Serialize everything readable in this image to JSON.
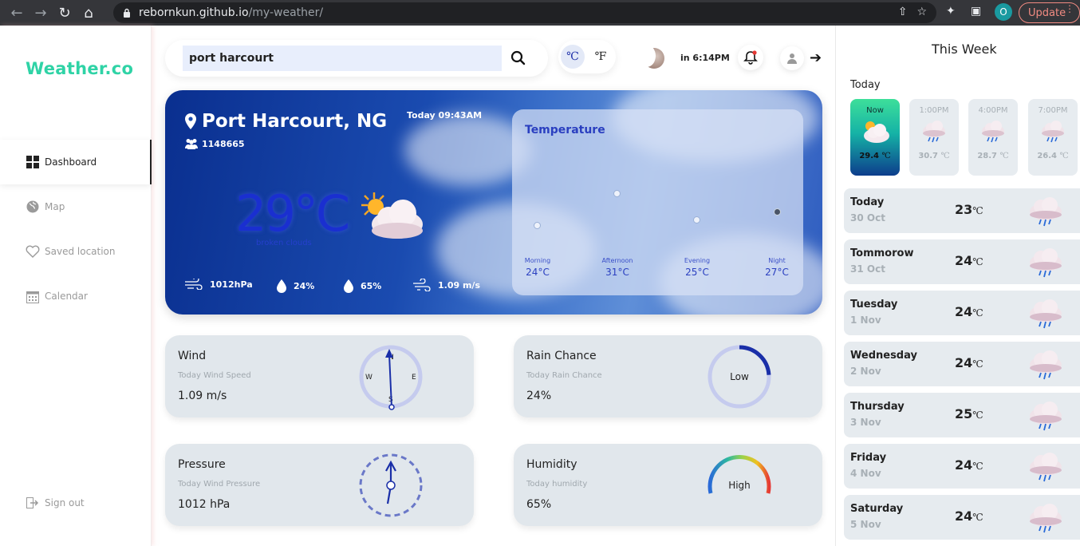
{
  "browser": {
    "url_host": "rebornkun.github.io",
    "url_path": "/my-weather/",
    "profile_initial": "O",
    "update_label": "Update"
  },
  "sidebar": {
    "logo": "Weather.co",
    "items": [
      {
        "label": "Dashboard",
        "icon": "dashboard-icon",
        "active": true
      },
      {
        "label": "Map",
        "icon": "globe-icon"
      },
      {
        "label": "Saved location",
        "icon": "heart-icon"
      },
      {
        "label": "Calendar",
        "icon": "calendar-icon"
      }
    ],
    "signout": "Sign out"
  },
  "topbar": {
    "search_value": "port harcourt",
    "unit_c": "℃",
    "unit_f": "℉",
    "time_text": "in 6:14PM"
  },
  "hero": {
    "city": "Port Harcourt, NG",
    "population": "1148665",
    "today_time": "Today 09:43AM",
    "temp": "29°C",
    "description": "broken clouds",
    "stats": {
      "pressure": "1012hPa",
      "humidity": "24%",
      "rain": "65%",
      "wind": "1.09 m/s"
    },
    "temperature_panel": {
      "title": "Temperature",
      "periods": [
        {
          "label": "Morning",
          "value": "24°C"
        },
        {
          "label": "Afternoon",
          "value": "31°C"
        },
        {
          "label": "Evening",
          "value": "25°C"
        },
        {
          "label": "Night",
          "value": "27°C"
        }
      ]
    }
  },
  "cards": {
    "wind": {
      "title": "Wind",
      "subtitle": "Today Wind Speed",
      "value": "1.09 m/s",
      "n": "N",
      "e": "E",
      "s": "S",
      "w": "W"
    },
    "rain": {
      "title": "Rain Chance",
      "subtitle": "Today Rain Chance",
      "value": "24%",
      "gauge_label": "Low",
      "gauge_fraction": 0.24
    },
    "pressure": {
      "title": "Pressure",
      "subtitle": "Today Wind Pressure",
      "value": "1012 hPa"
    },
    "humidity": {
      "title": "Humidity",
      "subtitle": "Today humidity",
      "value": "65%",
      "gauge_label": "High"
    }
  },
  "week": {
    "title": "This Week",
    "today_label": "Today",
    "hours": [
      {
        "time": "Now",
        "temp": "29.4",
        "unit": "℃",
        "icon": "sun-cloud-icon",
        "now": true
      },
      {
        "time": "1:00PM",
        "temp": "30.7",
        "unit": "℃",
        "icon": "rain-cloud-icon"
      },
      {
        "time": "4:00PM",
        "temp": "28.7",
        "unit": "℃",
        "icon": "rain-cloud-icon"
      },
      {
        "time": "7:00PM",
        "temp": "26.4",
        "unit": "℃",
        "icon": "rain-cloud-icon"
      }
    ],
    "days": [
      {
        "name": "Today",
        "date": "30 Oct",
        "temp": "23",
        "unit": "℃"
      },
      {
        "name": "Tommorow",
        "date": "31 Oct",
        "temp": "24",
        "unit": "℃"
      },
      {
        "name": "Tuesday",
        "date": "1 Nov",
        "temp": "24",
        "unit": "℃"
      },
      {
        "name": "Wednesday",
        "date": "2 Nov",
        "temp": "24",
        "unit": "℃"
      },
      {
        "name": "Thursday",
        "date": "3 Nov",
        "temp": "25",
        "unit": "℃"
      },
      {
        "name": "Friday",
        "date": "4 Nov",
        "temp": "24",
        "unit": "℃"
      },
      {
        "name": "Saturday",
        "date": "5 Nov",
        "temp": "24",
        "unit": "℃"
      }
    ]
  }
}
